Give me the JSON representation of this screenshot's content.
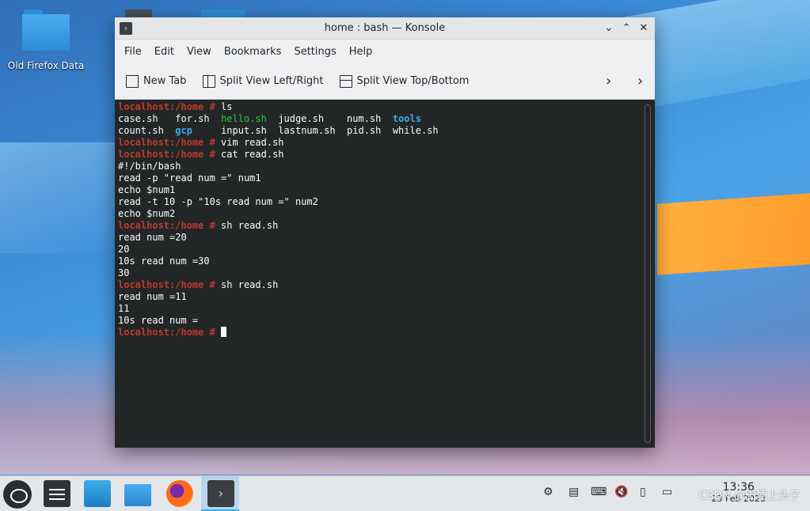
{
  "desktop": {
    "icon_label": "Old Firefox Data"
  },
  "window": {
    "title": "home : bash — Konsole",
    "controls": {
      "minimize": "⌄",
      "maximize": "⌃",
      "close": "✕"
    }
  },
  "menubar": [
    "File",
    "Edit",
    "View",
    "Bookmarks",
    "Settings",
    "Help"
  ],
  "toolbar": {
    "new_tab": "New Tab",
    "split_lr": "Split View Left/Right",
    "split_tb": "Split View Top/Bottom",
    "overflow1": "›",
    "overflow2": "›"
  },
  "terminal": {
    "prompt": "localhost:/home #",
    "l1_cmd": " ls",
    "ls1": [
      "case.sh",
      "for.sh",
      "hello.sh",
      "judge.sh",
      "num.sh",
      "tools"
    ],
    "ls2": [
      "count.sh",
      "gcp",
      "input.sh",
      "lastnum.sh",
      "pid.sh",
      "while.sh"
    ],
    "cmd_vim": " vim read.sh",
    "cmd_cat": " cat read.sh",
    "file": [
      "#!/bin/bash",
      "read -p \"read num =\" num1",
      "echo $num1",
      "read -t 10 -p \"10s read num =\" num2",
      "echo $num2"
    ],
    "cmd_sh": " sh read.sh",
    "run1": [
      "read num =20",
      "20",
      "10s read num =30",
      "30"
    ],
    "run2": [
      "read num =11",
      "11",
      "10s read num ="
    ]
  },
  "taskbar": {
    "time": "13:36",
    "date": "23 Feb 2023",
    "watermark": "CSDN @田埂上头子"
  }
}
